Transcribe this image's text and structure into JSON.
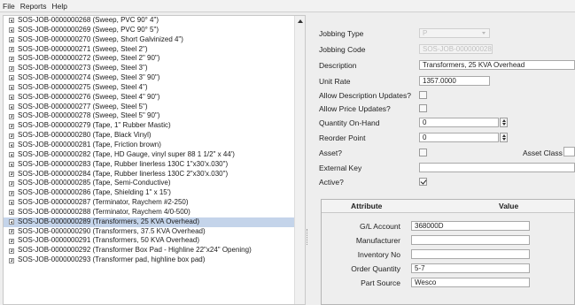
{
  "menu": [
    "File",
    "Reports",
    "Help"
  ],
  "tree": {
    "items": [
      {
        "label": "SOS-JOB-0000000268 (Sweep, PVC 90° 4\")",
        "selected": false
      },
      {
        "label": "SOS-JOB-0000000269 (Sweep, PVC 90° 5\")",
        "selected": false
      },
      {
        "label": "SOS-JOB-0000000270 (Sweep, Short Galvinized 4\")",
        "selected": false
      },
      {
        "label": "SOS-JOB-0000000271 (Sweep, Steel 2\")",
        "selected": false
      },
      {
        "label": "SOS-JOB-0000000272 (Sweep, Steel 2\" 90\")",
        "selected": false
      },
      {
        "label": "SOS-JOB-0000000273 (Sweep, Steel 3\")",
        "selected": false
      },
      {
        "label": "SOS-JOB-0000000274 (Sweep, Steel 3\" 90\")",
        "selected": false
      },
      {
        "label": "SOS-JOB-0000000275 (Sweep, Steel 4\")",
        "selected": false
      },
      {
        "label": "SOS-JOB-0000000276 (Sweep, Steel 4\" 90\")",
        "selected": false
      },
      {
        "label": "SOS-JOB-0000000277 (Sweep, Steel 5\")",
        "selected": false
      },
      {
        "label": "SOS-JOB-0000000278 (Sweep, Steel 5\" 90\")",
        "selected": false
      },
      {
        "label": "SOS-JOB-0000000279 (Tape,  1\" Rubber Mastic)",
        "selected": false
      },
      {
        "label": "SOS-JOB-0000000280 (Tape, Black Vinyl)",
        "selected": false
      },
      {
        "label": "SOS-JOB-0000000281 (Tape, Friction brown)",
        "selected": false
      },
      {
        "label": "SOS-JOB-0000000282 (Tape, HD Gauge, vinyl super 88  1 1/2\" x 44')",
        "selected": false
      },
      {
        "label": "SOS-JOB-0000000283 (Tape, Rubber linerless 130C 1\"x30'x.030\")",
        "selected": false
      },
      {
        "label": "SOS-JOB-0000000284 (Tape, Rubber linerless 130C 2\"x30'x.030\")",
        "selected": false
      },
      {
        "label": "SOS-JOB-0000000285 (Tape, Semi-Conductive)",
        "selected": false
      },
      {
        "label": "SOS-JOB-0000000286 (Tape, Shielding  1\" x 15')",
        "selected": false
      },
      {
        "label": "SOS-JOB-0000000287 (Terminator, Raychem #2-250)",
        "selected": false
      },
      {
        "label": "SOS-JOB-0000000288 (Terminator, Raychem 4/0-500)",
        "selected": false
      },
      {
        "label": "SOS-JOB-0000000289 (Transformers, 25 KVA Overhead)",
        "selected": true
      },
      {
        "label": "SOS-JOB-0000000290 (Transformers, 37.5 KVA Overhead)",
        "selected": false
      },
      {
        "label": "SOS-JOB-0000000291 (Transformers, 50 KVA Overhead)",
        "selected": false
      },
      {
        "label": "SOS-JOB-0000000292 (Transformer Box Pad - Highline 22\"x24\" Opening)",
        "selected": false
      },
      {
        "label": "SOS-JOB-0000000293 (Transformer pad, highline box pad)",
        "selected": false
      }
    ]
  },
  "form": {
    "jobbing_type_label": "Jobbing Type",
    "jobbing_type_value": "P",
    "jobbing_code_label": "Jobbing Code",
    "jobbing_code_value": "SOS-JOB-0000000289",
    "description_label": "Description",
    "description_value": "Transformers, 25 KVA Overhead",
    "unit_rate_label": "Unit Rate",
    "unit_rate_value": "1357.0000",
    "allow_desc_label": "Allow Description Updates?",
    "allow_desc_checked": false,
    "allow_price_label": "Allow Price Updates?",
    "allow_price_checked": false,
    "qty_on_hand_label": "Quantity On-Hand",
    "qty_on_hand_value": "0",
    "reorder_label": "Reorder Point",
    "reorder_value": "0",
    "asset_label": "Asset?",
    "asset_checked": false,
    "asset_class_label": "Asset Class",
    "asset_class_value": "",
    "external_key_label": "External Key",
    "external_key_value": "",
    "active_label": "Active?",
    "active_checked": true
  },
  "attributes": {
    "header_attribute": "Attribute",
    "header_value": "Value",
    "rows": [
      {
        "label": "G/L Account",
        "value": "368000D"
      },
      {
        "label": "Manufacturer",
        "value": ""
      },
      {
        "label": "Inventory No",
        "value": ""
      },
      {
        "label": "Order Quantity",
        "value": "5-7"
      },
      {
        "label": "Part Source",
        "value": "Wesco"
      }
    ]
  }
}
